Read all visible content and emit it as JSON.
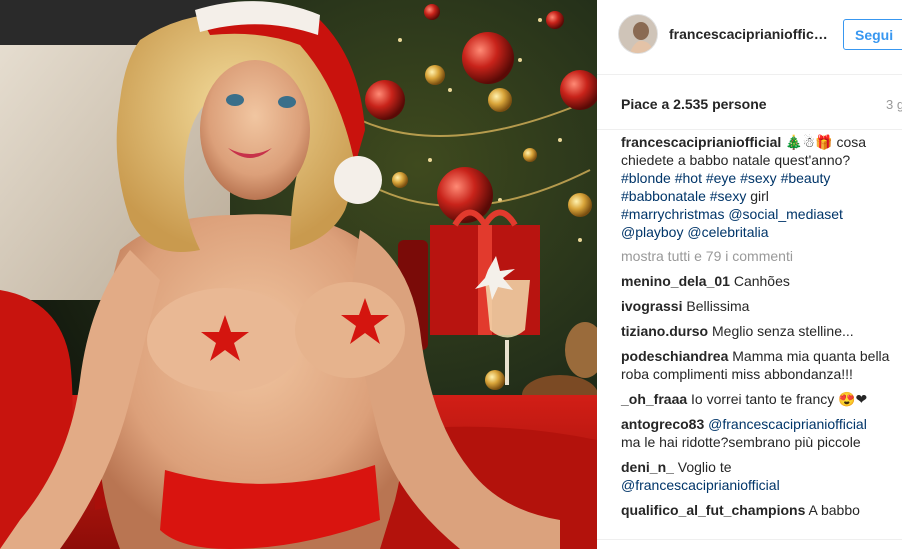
{
  "post": {
    "username": "francescaciprianiofficial",
    "follow_label": "Segui",
    "likes": "Piace a 2.535 persone",
    "time": "3 g",
    "caption": {
      "user": "francescaciprianiofficial",
      "emoji": "🎄☃🎁",
      "text": "cosa chiedete a babbo natale quest'anno?",
      "tags_line1": "#blonde #hot #eye #sexy #beauty",
      "tags_line2_a": "#babbonatale #sexy",
      "tags_line2_b": "girl",
      "tags_line3": "#marrychristmas @social_mediaset",
      "tags_line4": "@playboy @celebritalia"
    },
    "view_all": "mostra tutti e 79 i commenti",
    "comments": [
      {
        "user": "menino_dela_01",
        "text": "Canhões"
      },
      {
        "user": "ivograssi",
        "text": "Bellissima"
      },
      {
        "user": "tiziano.durso",
        "text": "Meglio senza stelline..."
      },
      {
        "user": "podeschiandrea",
        "text": "Mamma mia quanta bella roba complimenti miss abbondanza!!!"
      },
      {
        "user": "_oh_fraaa",
        "text": "Io vorrei tanto te francy 😍❤"
      },
      {
        "user": "antogreco83",
        "mention": "@francescaciprianiofficial",
        "text": "ma le hai ridotte?sembrano più piccole"
      },
      {
        "user": "deni_n_",
        "text": "Voglio te",
        "mention": "@francescaciprianiofficial"
      },
      {
        "user": "qualifico_al_fut_champions",
        "text": "A babbo"
      }
    ]
  },
  "colors": {
    "accent": "#3897f0",
    "tag": "#003569",
    "muted": "#999999",
    "background_red": "#c4140f"
  },
  "icons": {
    "media": "photo-christmas",
    "avatar": "profile-photo"
  }
}
